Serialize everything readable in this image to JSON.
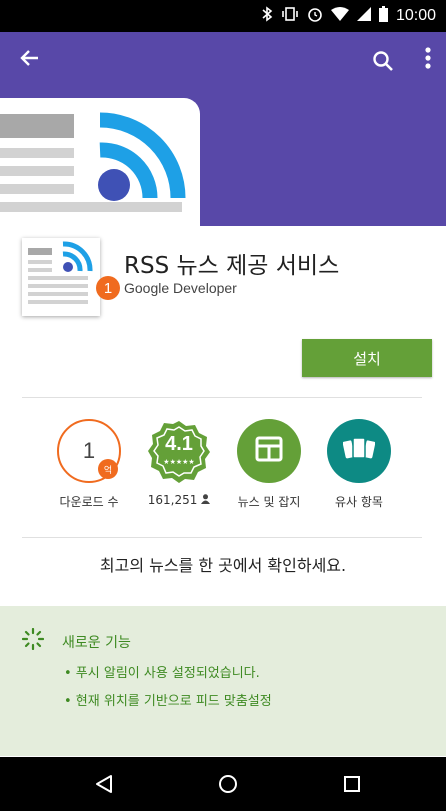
{
  "status_bar": {
    "time": "10:00",
    "icons": [
      "bluetooth-icon",
      "vibrate-icon",
      "alarm-icon",
      "wifi-icon",
      "signal-icon",
      "battery-icon"
    ]
  },
  "app_bar": {
    "back_icon": "arrow-back-icon",
    "search_icon": "search-icon",
    "more_icon": "more-vert-icon",
    "color": "#5848a8"
  },
  "app": {
    "title": "RSS 뉴스 제공 서비스",
    "developer_badge": "1",
    "developer": "Google Developer"
  },
  "install": {
    "label": "설치",
    "color": "#64a038"
  },
  "stats": {
    "downloads_value": "1",
    "downloads_unit": "억",
    "downloads_label": "다운로드 수",
    "rating_value": "4.1",
    "rating_stars": "★★★★★",
    "ratings_count": "161,251",
    "ratings_icon": "person-icon",
    "category_label": "뉴스 및 잡지",
    "similar_label": "유사 항목"
  },
  "promo_text": "최고의 뉴스를 한 곳에서 확인하세요.",
  "whats_new": {
    "title": "새로운 기능",
    "items": [
      "• 푸시 알림이 사용 설정되었습니다.",
      "• 현재 위치를 기반으로 피드 맞춤설정"
    ]
  },
  "nav_bar": {
    "back": "nav-back-icon",
    "home": "nav-home-icon",
    "recents": "nav-recents-icon"
  }
}
